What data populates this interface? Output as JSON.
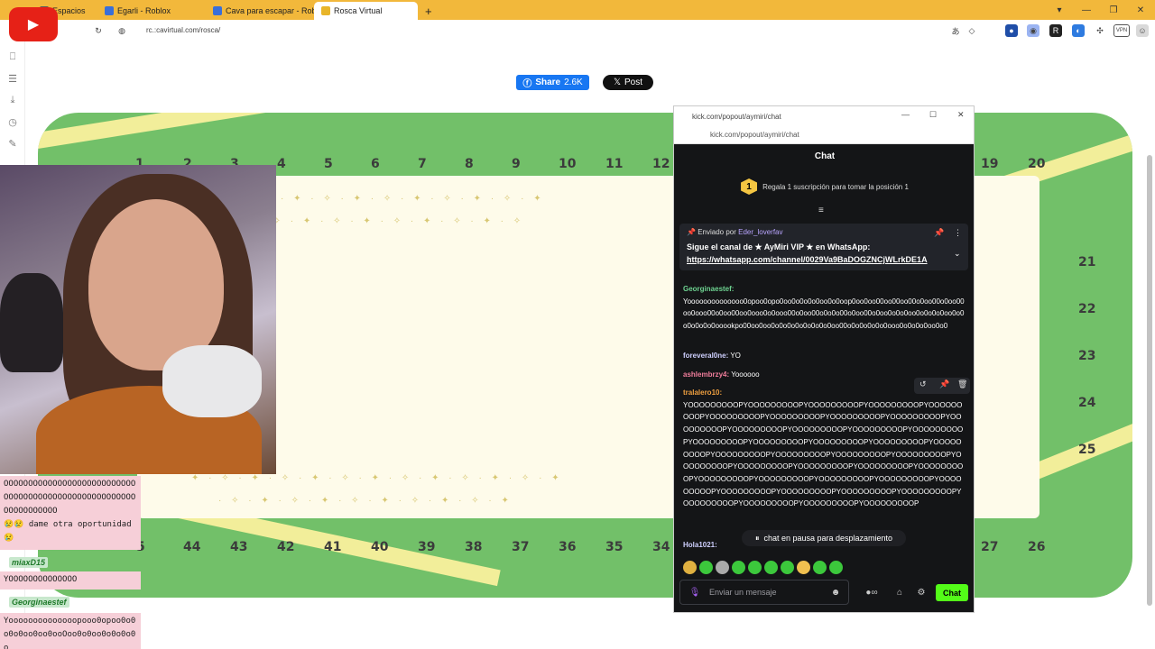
{
  "browser": {
    "tabs": [
      {
        "label": "Espacios",
        "color": "#5b5b5b",
        "active": false
      },
      {
        "label": "Egarli - Roblox",
        "color": "#3a6fd8",
        "active": false
      },
      {
        "label": "Cava para escapar - Rob",
        "color": "#3a6fd8",
        "active": false
      },
      {
        "label": "Rosca Virtual",
        "color": "#e8b52a",
        "active": true
      }
    ],
    "url": "rc.:cavirtual.com/rosca/"
  },
  "page": {
    "share_label": "Share",
    "share_count": "2.6K",
    "post_label": "Post",
    "top_numbers": [
      "1",
      "2",
      "3",
      "4",
      "5",
      "6",
      "7",
      "8",
      "9",
      "10",
      "11",
      "12",
      "19",
      "20"
    ],
    "right_numbers": [
      "21",
      "22",
      "23",
      "24",
      "25"
    ],
    "bottom_numbers": [
      "5",
      "44",
      "43",
      "42",
      "41",
      "40",
      "39",
      "38",
      "37",
      "36",
      "35",
      "34",
      "27",
      "26"
    ]
  },
  "overlay": {
    "lines1": "OOOOOOOOOOOOOOOOOOOOOOOOOOOOOOOOOOOOOOOOOOOOOOOOOOOOOOOOOOOOOOOOO",
    "line_dame": "😢😢 dame otra oportunidad",
    "emoji_tail": "😢",
    "user2": "miaxD15",
    "text2": "YOOOOOOOOOOOOOO",
    "user3": "Georginaestef",
    "text3": "Yoooooooooooooopooo0opoo0o0o0o0oo0oo0ooOoo0o0oo0o0o0o0o"
  },
  "chat": {
    "popout_url": "kick.com/popout/aymiri/chat",
    "header": "Chat",
    "gift_rank": "1",
    "gift_text": "Regala 1 suscripción para tomar la posición 1",
    "pinned_prefix": "Enviado por",
    "pinned_user": "Eder_loverfav",
    "pinned_text": "Sigue el canal de ★ AyMiri VIP ★ en WhatsApp:",
    "pinned_link": "https://whatsapp.com/channel/0029Va9BaDOGZNCjWLrkDE1A",
    "messages": [
      {
        "user": "Georginaestef",
        "color": "#6ed391",
        "text": "Yoooooooooooooo0opoo0opo0oo0o0o0o0oo0o0oop0oo0oo00oo00oo00o0oo00o0oo00oo0ooo00o0oo00oo0ooo0o0ooo00o0oo00o0o0o00o0oo00o0oo0o0o0oo0o0o0o0oo0o0o0o0o0o0ooookpo00oo0oo0o0o0o0o0o0o0o0oo00o0o0o0o0o0ooo0o0o0o0oo0o0"
      },
      {
        "user": "foreveral0ne",
        "color": "#cfd0ff",
        "text": "YO"
      },
      {
        "user": "ashlembrzy4",
        "color": "#f07d9b",
        "text": "Yoooooo"
      },
      {
        "user": "tralalero10",
        "color": "#f0a040",
        "text": "YOOOOOOOOOPYOOOOOOOOOPYOOOOOOOOOPYOOOOOOOOOPYOOOOOOOOOPYOOOOOOOOOPYOOOOOOOOOPYOOOOOOOOOPYOOOOOOOOOPYOOOOOOOOOPYOOOOOOOOOPYOOOOOOOOOPYOOOOOOOOOPYOOOOOOOOOPYOOOOOOOOOPYOOOOOOOOOPYOOOOOOOOOPYOOOOOOOOOPYOOOOOOOOOPYOOOOOOOOOPYOOOOOOOOOPYOOOOOOOOOPYOOOOOOOOOPYOOOOOOOOOPYOOOOOOOOOPYOOOOOOOOOPYOOOOOOOOOPYOOOOOOOOOPYOOOOOOOOOPYOOOOOOOOOPYOOOOOOOOOPYOOOOOOOOOPYOOOOOOOOOPYOOOOOOOOOPYOOOOOOOOOPYOOOOOOOOOPYOOOOOOOOOPYOOOOOOOOOPYOOOOOOOOOPYOOOOOOOOOPYOOOOOOOOOP"
      },
      {
        "user": "Hola1021",
        "color": "#cfd0ff",
        "text": ""
      }
    ],
    "pause_text": "chat en pausa para desplazamiento",
    "input_placeholder": "Enviar un mensaje",
    "send_label": "Chat"
  },
  "colors": {
    "board_green": "#72c069",
    "board_cream": "#fefbea",
    "kick_green": "#53fc18",
    "tab_orange": "#f2b83b"
  }
}
